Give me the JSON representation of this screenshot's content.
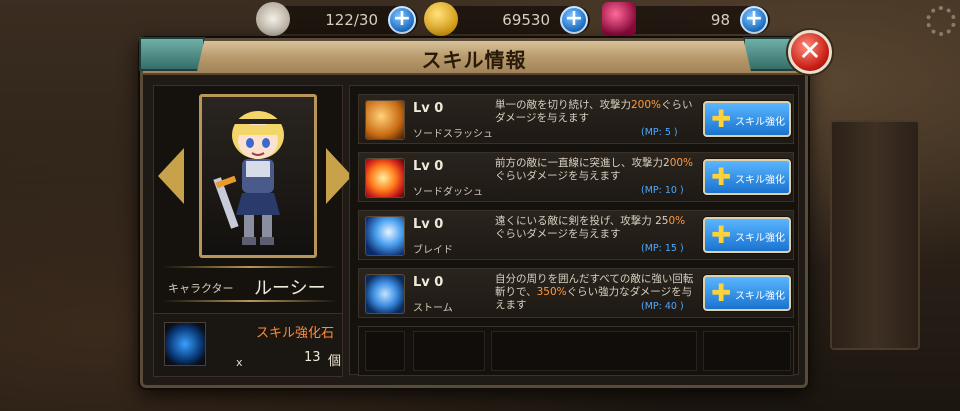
{
  "resources": {
    "stamina": {
      "value": "122/30",
      "icon": "wing-icon"
    },
    "gold": {
      "value": "69530",
      "icon": "gold-coin-icon"
    },
    "gems": {
      "value": "98",
      "icon": "ruby-gem-icon"
    },
    "plus_label": "+"
  },
  "window": {
    "title": "スキル情報",
    "close_label": "✕"
  },
  "character": {
    "label": "キャラクター",
    "name": "ルーシー"
  },
  "stone": {
    "label": "スキル強化石",
    "x": "x",
    "count": "13",
    "unit": "個"
  },
  "skills": [
    {
      "lv": "Lv 0",
      "name": "ソードスラッシュ",
      "desc_pre": "単一の敵を切り続け、攻撃力",
      "desc_hl": "200%",
      "desc_post": "ぐらいダメージを与えます",
      "mp": "(MP:  5 )",
      "button": "スキル強化",
      "icon": "sword-slash-icon"
    },
    {
      "lv": "Lv 0",
      "name": "ソードダッシュ",
      "desc_pre": "前方の敵に一直線に突進し、攻撃力2",
      "desc_hl": "00%",
      "desc_post": "ぐらいダメージを与えます",
      "mp": "(MP: 10 )",
      "button": "スキル強化",
      "icon": "sword-dash-icon"
    },
    {
      "lv": "Lv 0",
      "name": "ブレイド",
      "desc_pre": "遠くにいる敵に剣を投げ、攻撃力 25",
      "desc_hl": "0%",
      "desc_post": "ぐらいダメージを与えます",
      "mp": "(MP: 15 )",
      "button": "スキル強化",
      "icon": "blade-throw-icon"
    },
    {
      "lv": "Lv 0",
      "name": "ストーム",
      "desc_pre": "自分の周りを囲んだすべての敵に強い回転斬りで、",
      "desc_hl": "350%",
      "desc_post": "ぐらい強力なダメージを与えます",
      "mp": "(MP: 40 )",
      "button": "スキル強化",
      "icon": "storm-spin-icon"
    }
  ]
}
